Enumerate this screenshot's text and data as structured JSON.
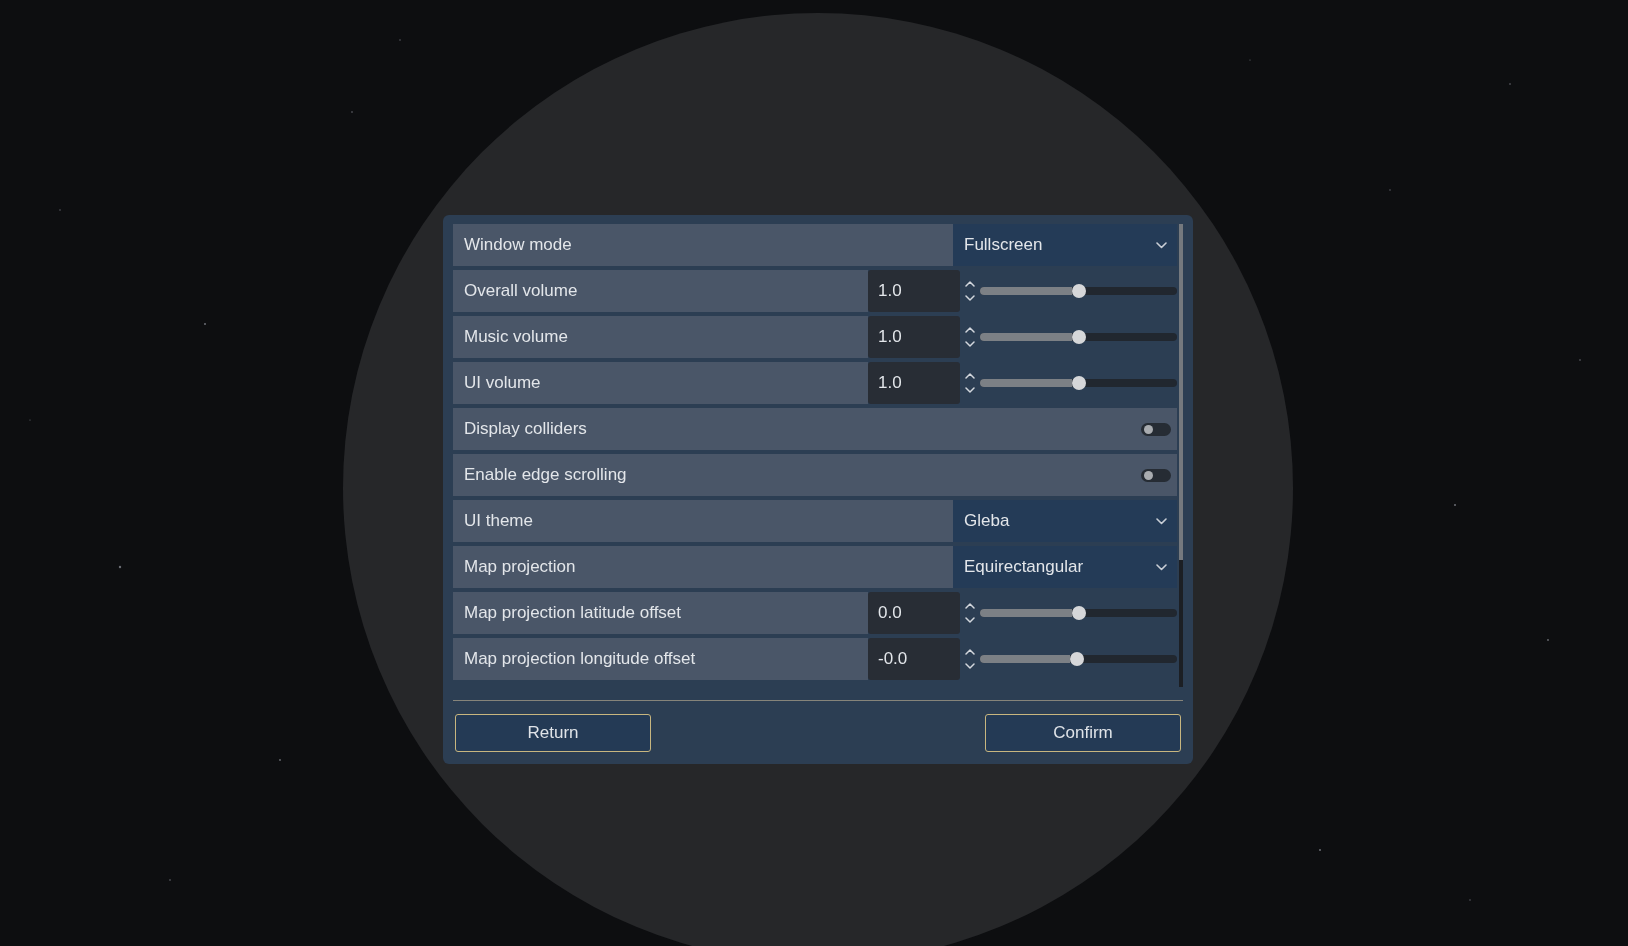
{
  "settings": [
    {
      "kind": "dropdown",
      "label": "Window mode",
      "value": "Fullscreen"
    },
    {
      "kind": "slider",
      "label": "Overall volume",
      "value": "1.0",
      "level": 0.5
    },
    {
      "kind": "slider",
      "label": "Music volume",
      "value": "1.0",
      "level": 0.5
    },
    {
      "kind": "slider",
      "label": "UI volume",
      "value": "1.0",
      "level": 0.5
    },
    {
      "kind": "toggle",
      "label": "Display colliders",
      "on": false
    },
    {
      "kind": "toggle",
      "label": "Enable edge scrolling",
      "on": false
    },
    {
      "kind": "dropdown",
      "label": "UI theme",
      "value": "Gleba"
    },
    {
      "kind": "dropdown",
      "label": "Map projection",
      "value": "Equirectangular"
    },
    {
      "kind": "slider",
      "label": "Map projection latitude offset",
      "value": "0.0",
      "level": 0.5
    },
    {
      "kind": "slider",
      "label": "Map projection longitude offset",
      "value": "-0.0",
      "level": 0.49
    }
  ],
  "buttons": [
    "Return",
    "Confirm"
  ]
}
